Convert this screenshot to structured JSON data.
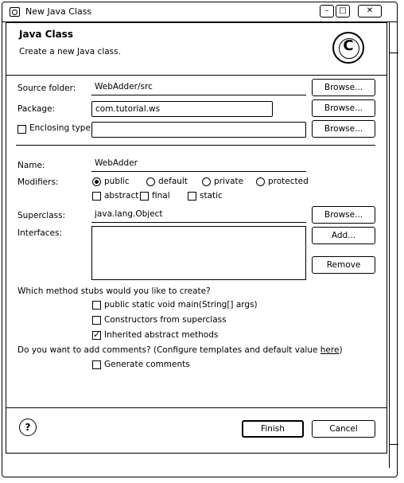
{
  "window": {
    "title": "New Java Class",
    "controls": {
      "minimize": "–",
      "maximize": "□",
      "close": "✕"
    }
  },
  "header": {
    "title": "Java Class",
    "description": "Create a new Java class."
  },
  "form": {
    "source_folder": {
      "label": "Source folder:",
      "value": "WebAdder/src",
      "button": "Browse..."
    },
    "package": {
      "label": "Package:",
      "value": "com.tutorial.ws",
      "button": "Browse..."
    },
    "enclosing_type": {
      "label": "Enclosing type:",
      "value": "",
      "checked": false,
      "button": "Browse..."
    },
    "name": {
      "label": "Name:",
      "value": "WebAdder"
    },
    "modifiers": {
      "label": "Modifiers:",
      "access": [
        {
          "label": "public",
          "selected": true
        },
        {
          "label": "default",
          "selected": false
        },
        {
          "label": "private",
          "selected": false
        },
        {
          "label": "protected",
          "selected": false
        }
      ],
      "flags": [
        {
          "label": "abstract",
          "checked": false
        },
        {
          "label": "final",
          "checked": false
        },
        {
          "label": "static",
          "checked": false
        }
      ]
    },
    "superclass": {
      "label": "Superclass:",
      "value": "java.lang.Object",
      "button": "Browse..."
    },
    "interfaces": {
      "label": "Interfaces:",
      "add_button": "Add...",
      "remove_button": "Remove",
      "items": []
    }
  },
  "stubs": {
    "question": "Which method stubs would you like to create?",
    "options": [
      {
        "label": "public static void main(String[] args)",
        "checked": false
      },
      {
        "label": "Constructors from superclass",
        "checked": false
      },
      {
        "label": "Inherited abstract methods",
        "checked": true
      }
    ]
  },
  "comments": {
    "question": "Do you want to add comments? (Configure templates and default value ",
    "link": "here",
    "question_end": ")",
    "option": {
      "label": "Generate comments",
      "checked": false
    }
  },
  "footer": {
    "help_icon": "?",
    "finish_label": "Finish",
    "cancel_label": "Cancel"
  },
  "icons": [
    "app-icon",
    "java-class-wizard-icon",
    "help-icon"
  ]
}
